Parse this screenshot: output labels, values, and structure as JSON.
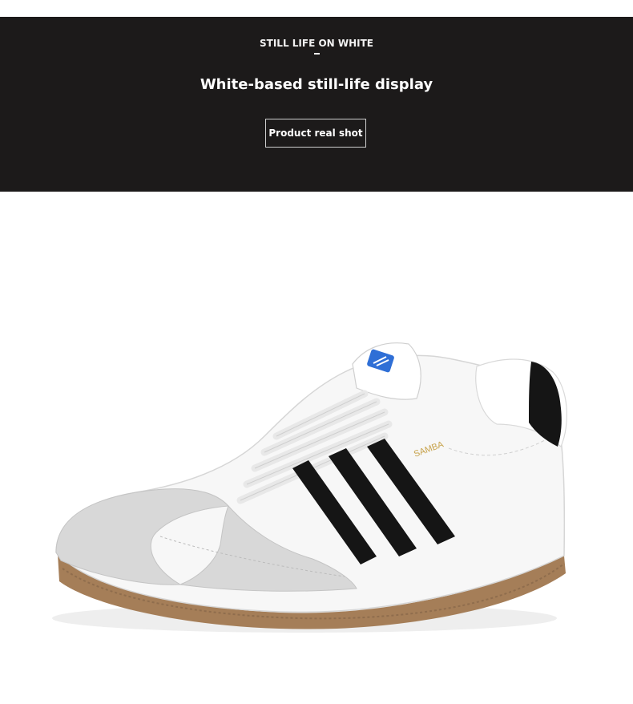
{
  "banner": {
    "kicker": "STILL LIFE ON WHITE",
    "headline": "White-based still-life display",
    "tag": "Product real shot"
  },
  "product_image": {
    "icon": "sneaker-photo",
    "tongue_label": "SAMBA"
  },
  "colors": {
    "banner_bg": "#1c1a1a",
    "page_bg": "#ffffff",
    "stripe": "#151515",
    "suede": "#d8d8d8",
    "gum_sole": "#a57e58",
    "brand_blue": "#2f6fd6",
    "gold_text": "#c7a24a"
  }
}
